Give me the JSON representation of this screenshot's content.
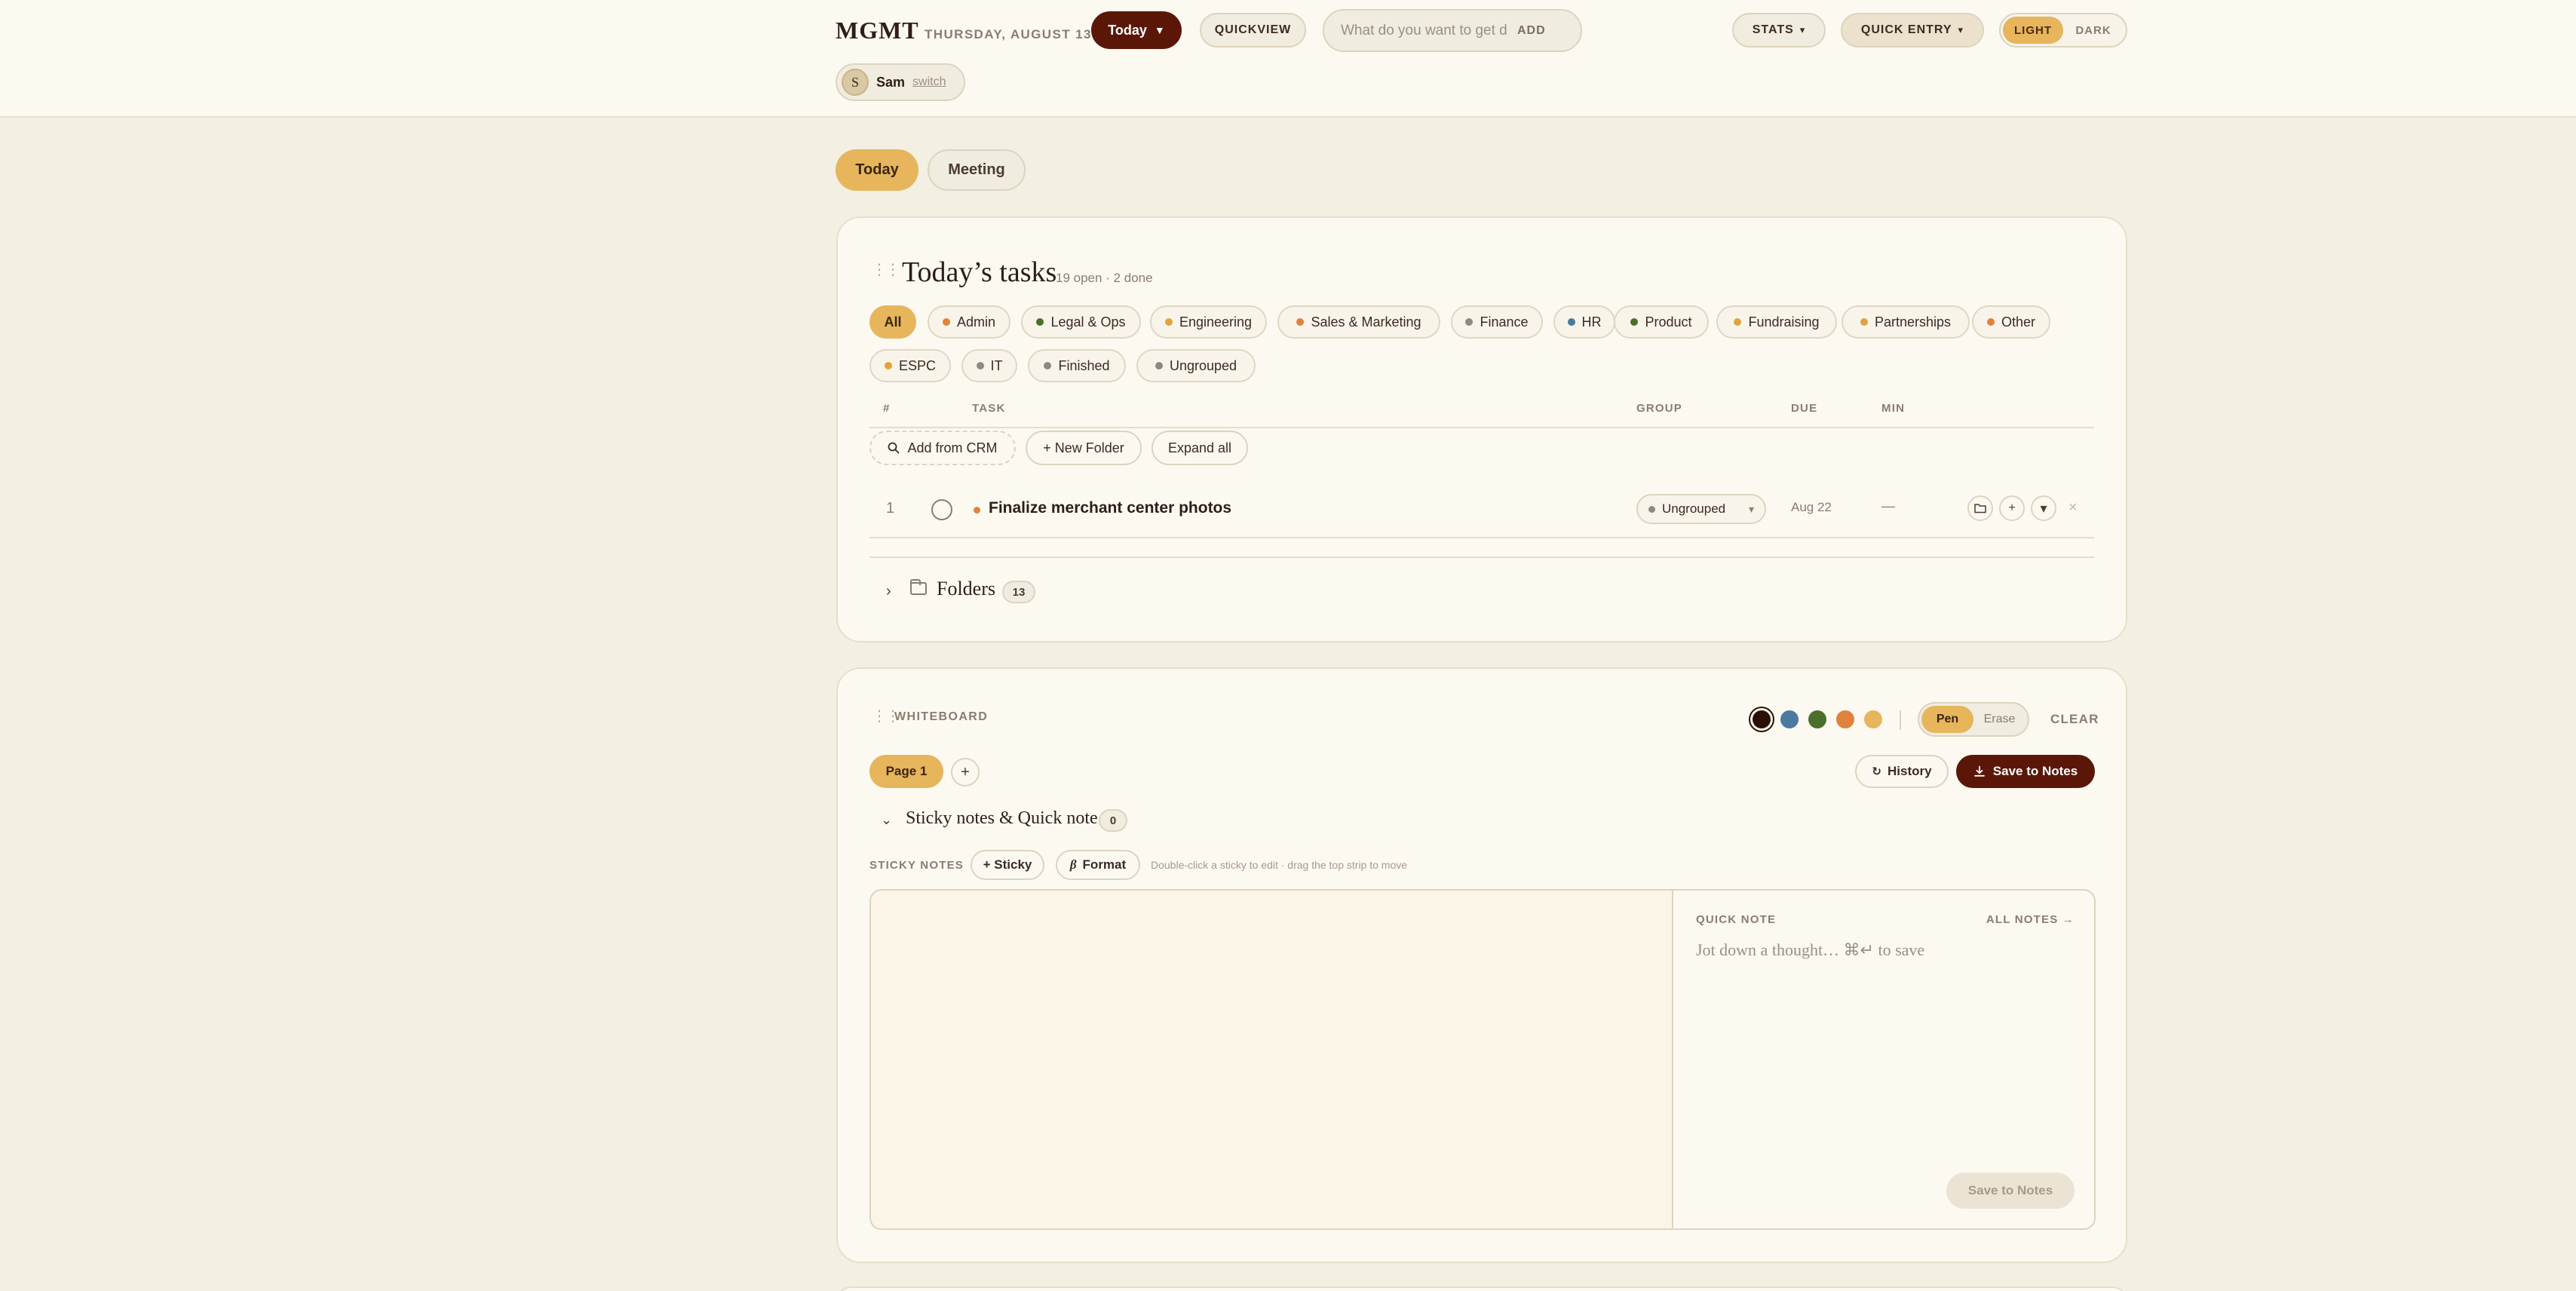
{
  "header": {
    "brand": "MGMT",
    "date": "THURSDAY, AUGUST 13",
    "today_button": "Today",
    "today_caret": "▼",
    "quickview": "QUICKVIEW",
    "search_placeholder": "What do you want to get done?",
    "search_add": "ADD",
    "stats": "STATS",
    "quick_entry": "QUICK ENTRY",
    "caret": "▾",
    "theme": {
      "light": "LIGHT",
      "dark": "DARK",
      "selected": "LIGHT"
    },
    "user": {
      "initial": "S",
      "name": "Sam",
      "switch": "switch"
    }
  },
  "page_tabs": [
    {
      "label": "Today",
      "active": true
    },
    {
      "label": "Meeting",
      "active": false
    }
  ],
  "tasks": {
    "title": "Today’s tasks",
    "subtitle": "19 open · 2 done",
    "filters": [
      {
        "label": "All",
        "active": true
      },
      {
        "label": "Admin",
        "color": "#e0823e"
      },
      {
        "label": "Legal & Ops",
        "color": "#4b6f2a"
      },
      {
        "label": "Engineering",
        "color": "#e0a33e"
      },
      {
        "label": "Sales & Marketing",
        "color": "#e0823e"
      },
      {
        "label": "Finance",
        "color": "#8a8a85"
      },
      {
        "label": "HR",
        "color": "#4a7aa0"
      },
      {
        "label": "Product",
        "color": "#4b6f2a"
      },
      {
        "label": "Fundraising",
        "color": "#e0a33e"
      },
      {
        "label": "Partnerships",
        "color": "#e0a33e"
      },
      {
        "label": "Other",
        "color": "#e0823e"
      },
      {
        "label": "ESPC",
        "color": "#e0a33e"
      },
      {
        "label": "IT",
        "color": "#8a8a85"
      },
      {
        "label": "Finished",
        "color": "#8a8a85"
      },
      {
        "label": "Ungrouped",
        "color": "#8a8a85"
      }
    ],
    "columns": {
      "num": "#",
      "task": "TASK",
      "group": "GROUP",
      "due": "DUE",
      "min": "MIN"
    },
    "actions": {
      "add_crm": "Add from CRM",
      "new_folder": "+ New Folder",
      "expand_all": "Expand all"
    },
    "rows": [
      {
        "num": "1",
        "title": "Finalize merchant center photos",
        "group": "Ungrouped",
        "due": "Aug 22",
        "min": "—"
      }
    ],
    "row_icons": {
      "add": "+",
      "more": "▾",
      "remove": "×"
    },
    "folders": {
      "label": "Folders",
      "count": "13"
    }
  },
  "whiteboard": {
    "label": "WHITEBOARD",
    "swatches": [
      "#2a0f06",
      "#4a7aa0",
      "#4b6f2a",
      "#e0823e",
      "#e6b55c"
    ],
    "pen": "Pen",
    "erase": "Erase",
    "clear": "CLEAR",
    "page_tab": "Page 1",
    "page_add": "+",
    "history": "History",
    "save_to_notes": "Save to Notes",
    "sticky_section": {
      "title": "Sticky notes & Quick note",
      "count": "0"
    },
    "sticky_label": "STICKY NOTES",
    "add_sticky": "+ Sticky",
    "format": "Format",
    "format_glyph": "β",
    "hint": "Double-click a sticky to edit · drag the top strip to move",
    "quick_note": {
      "label": "QUICK NOTE",
      "all_notes": "ALL NOTES →",
      "placeholder": "Jot down a thought… ⌘↵ to save",
      "save": "Save to Notes"
    }
  }
}
